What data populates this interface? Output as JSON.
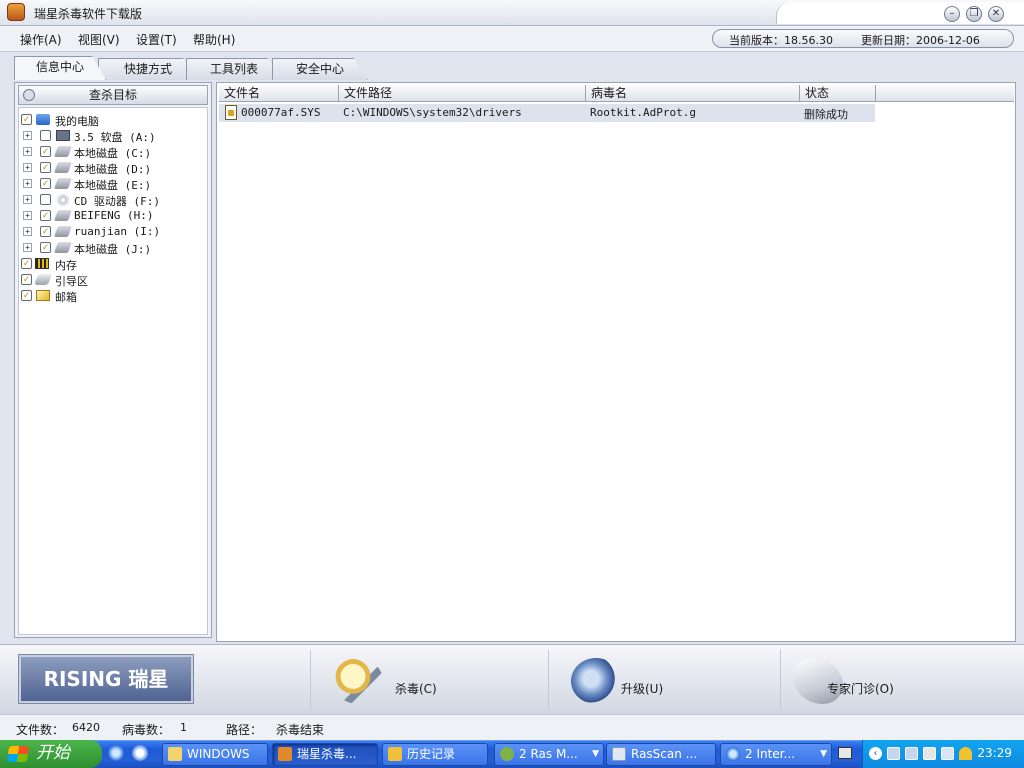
{
  "window": {
    "title": "瑞星杀毒软件下载版"
  },
  "menu": [
    "操作(A)",
    "视图(V)",
    "设置(T)",
    "帮助(H)"
  ],
  "version": {
    "current_label": "当前版本：18.56.30",
    "update_label": "更新日期：2006-12-06"
  },
  "tabs": [
    "信息中心",
    "快捷方式",
    "工具列表",
    "安全中心"
  ],
  "scan_targets": {
    "header": "查杀目标",
    "items": [
      {
        "label": "我的电脑",
        "checked": true,
        "icon": "computer-icon",
        "level": 0
      },
      {
        "label": "3.5 软盘  (A:)",
        "checked": false,
        "icon": "floppy-icon",
        "level": 1
      },
      {
        "label": "本地磁盘  (C:)",
        "checked": true,
        "icon": "hard-disk-icon",
        "level": 1
      },
      {
        "label": "本地磁盘  (D:)",
        "checked": true,
        "icon": "hard-disk-icon",
        "level": 1
      },
      {
        "label": "本地磁盘  (E:)",
        "checked": true,
        "icon": "hard-disk-icon",
        "level": 1
      },
      {
        "label": "CD 驱动器  (F:)",
        "checked": false,
        "icon": "cd-drive-icon",
        "level": 1
      },
      {
        "label": "BEIFENG  (H:)",
        "checked": true,
        "icon": "hard-disk-icon",
        "level": 1
      },
      {
        "label": "ruanjian  (I:)",
        "checked": true,
        "icon": "hard-disk-icon",
        "level": 1
      },
      {
        "label": "本地磁盘  (J:)",
        "checked": true,
        "icon": "hard-disk-icon",
        "level": 1
      },
      {
        "label": "内存",
        "checked": true,
        "icon": "memory-icon",
        "level": 0
      },
      {
        "label": "引导区",
        "checked": true,
        "icon": "boot-sector-icon",
        "level": 0
      },
      {
        "label": "邮箱",
        "checked": true,
        "icon": "mailbox-icon",
        "level": 0
      }
    ]
  },
  "results": {
    "columns": [
      "文件名",
      "文件路径",
      "病毒名",
      "状态"
    ],
    "rows": [
      {
        "file": "000077af.SYS",
        "path": "C:\\WINDOWS\\system32\\drivers",
        "virus": "Rootkit.AdProt.g",
        "status": "删除成功"
      }
    ]
  },
  "actions": {
    "logo": "RISING 瑞星",
    "scan": "杀毒(C)",
    "upgrade": "升级(U)",
    "expert": "专家门诊(O)"
  },
  "status": {
    "files_label": "文件数：",
    "files_value": "6420",
    "virus_label": "病毒数：",
    "virus_value": "1",
    "path_label": "路径：",
    "path_value": "杀毒结束"
  },
  "taskbar": {
    "start": "开始",
    "tasks": [
      "WINDOWS",
      "瑞星杀毒...",
      "历史记录",
      "2 Ras M...",
      "RasScan ...",
      "2 Inter..."
    ],
    "clock": "23:29"
  }
}
